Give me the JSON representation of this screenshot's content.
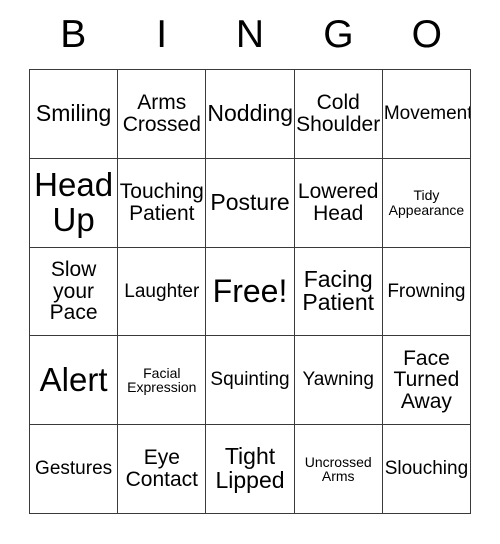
{
  "card": {
    "title_letters": [
      "B",
      "I",
      "N",
      "G",
      "O"
    ],
    "rows": [
      [
        {
          "text": "Smiling",
          "size": "md"
        },
        {
          "text": "Arms\nCrossed",
          "size": "sm"
        },
        {
          "text": "Nodding",
          "size": "md"
        },
        {
          "text": "Cold\nShoulder",
          "size": "sm"
        },
        {
          "text": "Movements",
          "size": "xs"
        }
      ],
      [
        {
          "text": "Head\nUp",
          "size": "xl"
        },
        {
          "text": "Touching\nPatient",
          "size": "sm"
        },
        {
          "text": "Posture",
          "size": "md"
        },
        {
          "text": "Lowered\nHead",
          "size": "sm"
        },
        {
          "text": "Tidy\nAppearance",
          "size": "xxs"
        }
      ],
      [
        {
          "text": "Slow\nyour\nPace",
          "size": "sm"
        },
        {
          "text": "Laughter",
          "size": "xs"
        },
        {
          "text": "Free!",
          "size": "lg"
        },
        {
          "text": "Facing\nPatient",
          "size": "md"
        },
        {
          "text": "Frowning",
          "size": "xs"
        }
      ],
      [
        {
          "text": "Alert",
          "size": "xl"
        },
        {
          "text": "Facial\nExpression",
          "size": "xxs"
        },
        {
          "text": "Squinting",
          "size": "xs"
        },
        {
          "text": "Yawning",
          "size": "xs"
        },
        {
          "text": "Face\nTurned\nAway",
          "size": "sm"
        }
      ],
      [
        {
          "text": "Gestures",
          "size": "xs"
        },
        {
          "text": "Eye\nContact",
          "size": "sm"
        },
        {
          "text": "Tight\nLipped",
          "size": "md"
        },
        {
          "text": "Uncrossed\nArms",
          "size": "xxs"
        },
        {
          "text": "Slouching",
          "size": "xs"
        }
      ]
    ]
  },
  "colors": {
    "border": "#3a3a3a",
    "text": "#000000",
    "background": "#ffffff"
  }
}
